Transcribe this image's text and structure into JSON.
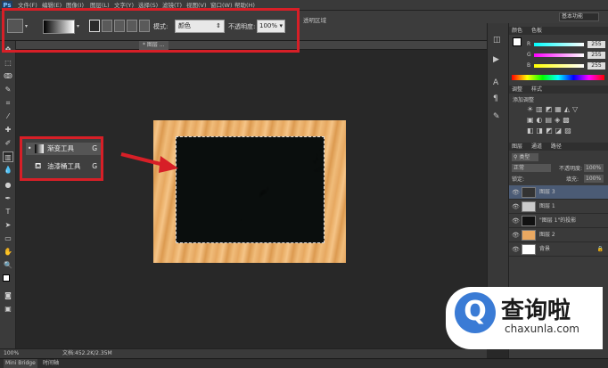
{
  "app": {
    "logo": "Ps"
  },
  "menu": [
    "文件(F)",
    "编辑(E)",
    "图像(I)",
    "图层(L)",
    "文字(Y)",
    "选择(S)",
    "滤镜(T)",
    "视图(V)",
    "窗口(W)",
    "帮助(H)"
  ],
  "workspace": "基本功能",
  "options_bar": {
    "mode_label": "模式:",
    "mode_value": "颜色",
    "opacity_label": "不透明度:",
    "opacity_value": "100%",
    "extra_label": "透明区域"
  },
  "doc_tab": "* 图层 ...",
  "flyout": {
    "items": [
      {
        "label": "渐变工具",
        "shortcut": "G"
      },
      {
        "label": "油漆桶工具",
        "shortcut": "G"
      }
    ]
  },
  "status": {
    "zoom": "100%",
    "doc": "文档:452.2K/2.35M"
  },
  "bottom": {
    "tab1": "Mini Bridge",
    "tab2": "时间轴"
  },
  "panels": {
    "color_tab": "颜色",
    "swatch_tab": "色板",
    "r_value": "255",
    "g_value": "255",
    "b_value": "255",
    "adjust_tab": "调整",
    "styles_tab": "样式",
    "adjust_hint": "添加调整",
    "layers_tab": "图层",
    "channels_tab": "通道",
    "paths_tab": "路径",
    "kind_filter": "类型",
    "blend_mode": "正常",
    "opacity_label": "不透明度:",
    "opacity_value": "100%",
    "lock_label": "锁定:",
    "fill_label": "填充:",
    "fill_value": "100%",
    "layers": [
      {
        "name": "图层 3"
      },
      {
        "name": "图层 1"
      },
      {
        "name": "\"图层 1\"的投影"
      },
      {
        "name": "图层 2"
      },
      {
        "name": "背景"
      }
    ]
  },
  "watermark": {
    "cn": "查询啦",
    "en": "chaxunla.com"
  },
  "colors": {
    "accent_red": "#d71f27",
    "brand_blue": "#3a7bd5"
  }
}
